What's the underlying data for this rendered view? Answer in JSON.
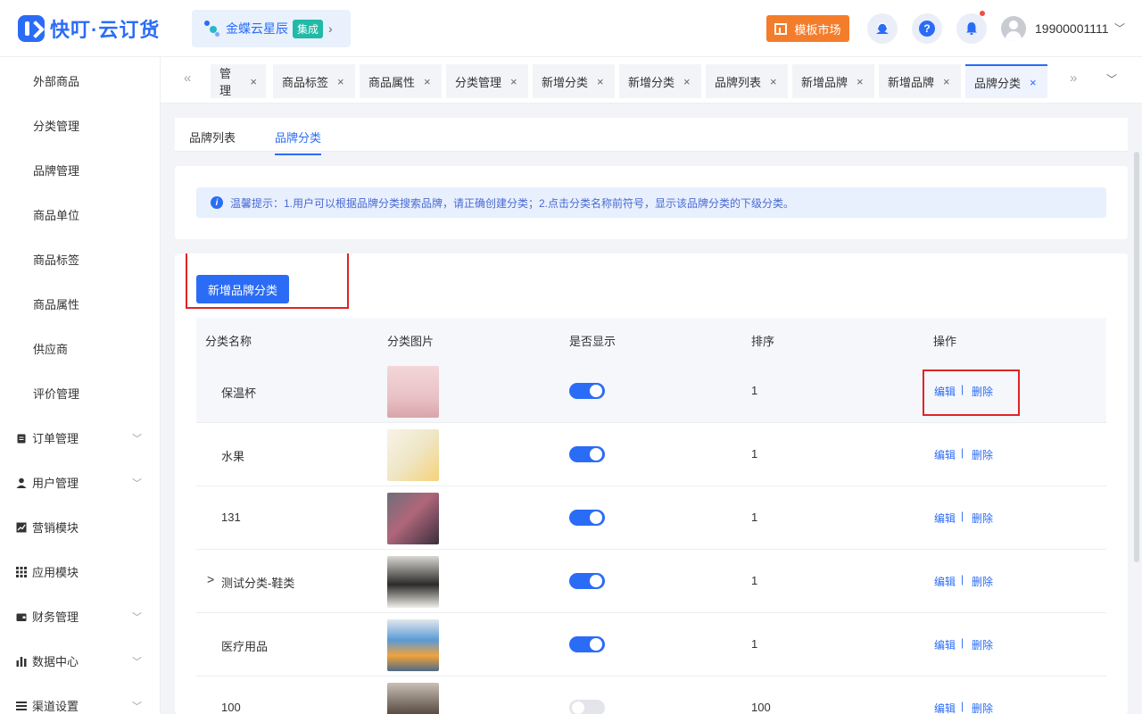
{
  "header": {
    "brand": "快叮·云订货",
    "kingdee_name": "金蝶云星辰",
    "kingdee_badge": "集成",
    "kingdee_arrow": "›",
    "template_market": "模板市场",
    "username": "19900001111",
    "user_arrow": "﹀"
  },
  "sidebar": {
    "sub_items": [
      "外部商品",
      "分类管理",
      "品牌管理",
      "商品单位",
      "商品标签",
      "商品属性",
      "供应商",
      "评价管理"
    ],
    "main_items": [
      {
        "label": "订单管理",
        "icon": "clipboard-icon",
        "has_arrow": true
      },
      {
        "label": "用户管理",
        "icon": "user-icon",
        "has_arrow": true
      },
      {
        "label": "营销模块",
        "icon": "chart-icon",
        "has_arrow": false
      },
      {
        "label": "应用模块",
        "icon": "grid-icon",
        "has_arrow": false
      },
      {
        "label": "财务管理",
        "icon": "wallet-icon",
        "has_arrow": true
      },
      {
        "label": "数据中心",
        "icon": "bar-chart-icon",
        "has_arrow": true
      },
      {
        "label": "渠道设置",
        "icon": "menu-icon",
        "has_arrow": true
      }
    ],
    "chevron": "﹀"
  },
  "tabs": {
    "scroll_left": "«",
    "scroll_right": "»",
    "more": "﹀",
    "close": "×",
    "items": [
      "管理",
      "商品标签",
      "商品属性",
      "分类管理",
      "新增分类",
      "新增分类",
      "品牌列表",
      "新增品牌",
      "新增品牌",
      "品牌分类"
    ],
    "active_index": 9
  },
  "subtabs": [
    "品牌列表",
    "品牌分类"
  ],
  "notice": {
    "icon_text": "i",
    "text": "温馨提示：1.用户可以根据品牌分类搜索品牌，请正确创建分类；2.点击分类名称前符号，显示该品牌分类的下级分类。"
  },
  "add_button": "新增品牌分类",
  "table": {
    "headers": [
      "分类名称",
      "分类图片",
      "是否显示",
      "排序",
      "操作"
    ],
    "edit_label": "编辑",
    "delete_label": "删除",
    "sep": "|",
    "expand_glyph": ">",
    "rows": [
      {
        "name": "保温杯",
        "image": "thermos-cup-image",
        "shown": true,
        "sort": "1",
        "expandable": false
      },
      {
        "name": "水果",
        "image": "fruit-box-image",
        "shown": true,
        "sort": "1",
        "expandable": false
      },
      {
        "name": "131",
        "image": "toy-car-image",
        "shown": true,
        "sort": "1",
        "expandable": false
      },
      {
        "name": "测试分类-鞋类",
        "image": "shoes-image",
        "shown": true,
        "sort": "1",
        "expandable": true
      },
      {
        "name": "医疗用品",
        "image": "water-bottles-image",
        "shown": true,
        "sort": "1",
        "expandable": false
      },
      {
        "name": "100",
        "image": "room-image",
        "shown": false,
        "sort": "100",
        "expandable": false
      }
    ]
  },
  "colors": {
    "accent": "#2b6cf6",
    "template_button": "#f47d2b",
    "highlight_box": "#e02424",
    "integration_badge": "#21b9a7"
  }
}
